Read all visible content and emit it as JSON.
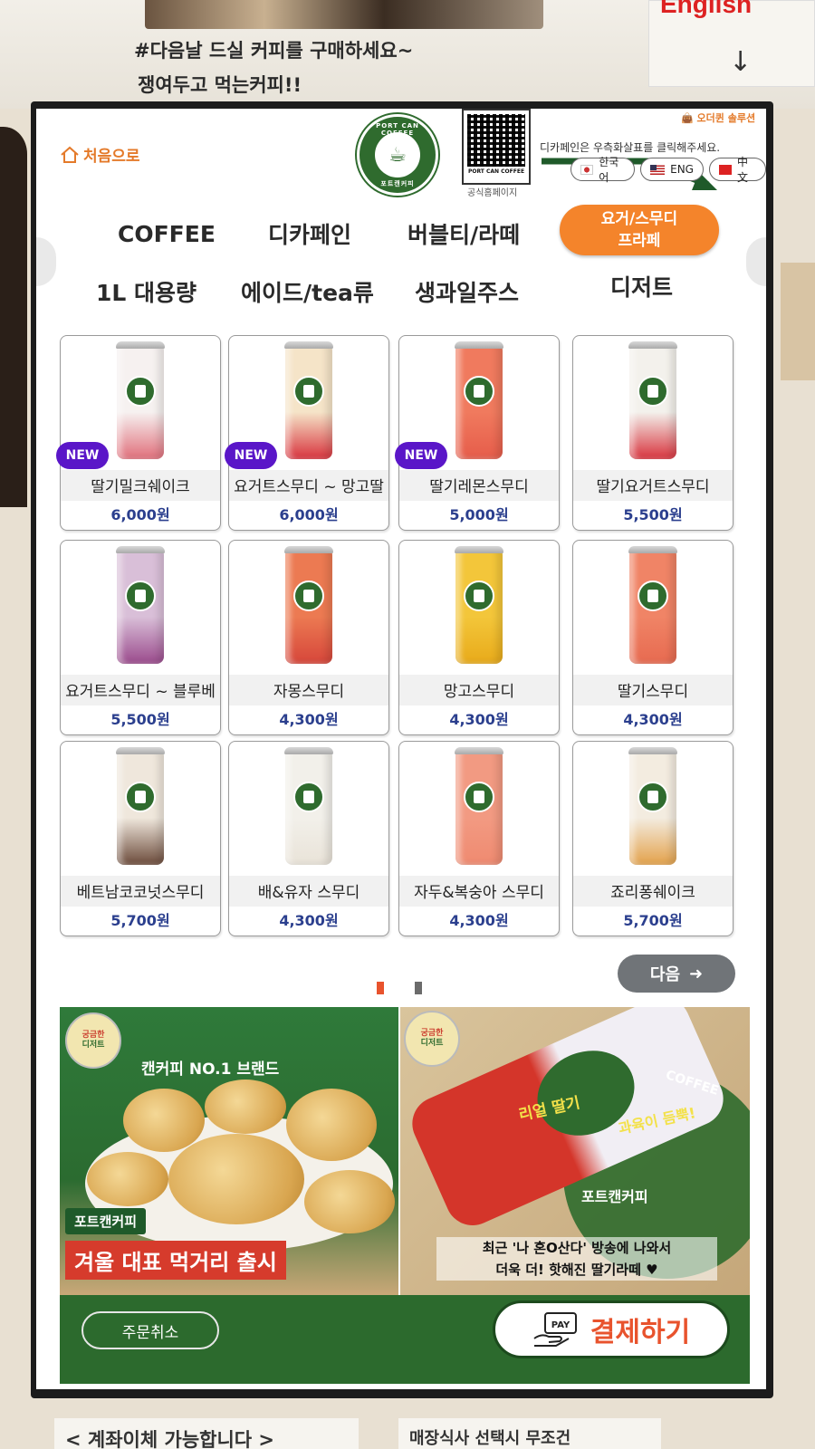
{
  "surroundings": {
    "sticker_line1": "#다음날 드실 커피를 구매하세요~",
    "sticker_line2": "쟁여두고 먹는커피!!",
    "english_sign": "English",
    "bottom_sign_left": "< 계좌이체 가능합니다 >",
    "bottom_sign_right": "매장식사 선택시 무조건"
  },
  "header": {
    "home_label": "처음으로",
    "logo_top": "PORT CAN COFFEE",
    "logo_bottom": "포트캔커피",
    "qr_caption": "PORT CAN COFFEE",
    "qr_label": "공식홈페이지",
    "solution_badge": "오더퀸 솔루션",
    "decaf_notice": "디카페인은 우측화살표를 클릭해주세요.",
    "languages": [
      {
        "label": "한국어",
        "flag": "kr"
      },
      {
        "label": "ENG",
        "flag": "us"
      },
      {
        "label": "中文",
        "flag": "cn"
      }
    ]
  },
  "categories": {
    "row1": [
      "COFFEE",
      "디카페인",
      "버블티/라떼"
    ],
    "active_line1": "요거/스무디",
    "active_line2": "프라페",
    "row2": [
      "1L 대용량",
      "에이드/tea류",
      "생과일주스",
      "디저트"
    ]
  },
  "products": [
    {
      "name": "딸기밀크쉐이크",
      "price": "6,000원",
      "is_new": true,
      "can_color": "#f6f1f0",
      "accent": "#e06e7a"
    },
    {
      "name": "요거트스무디 ~ 망고딸",
      "price": "6,000원",
      "is_new": true,
      "can_color": "#f5e4c8",
      "accent": "#d8323c"
    },
    {
      "name": "딸기레몬스무디",
      "price": "5,000원",
      "is_new": true,
      "can_color": "#f07a5e",
      "accent": "#e65c4a"
    },
    {
      "name": "딸기요거트스무디",
      "price": "5,500원",
      "is_new": false,
      "can_color": "#f3f1ec",
      "accent": "#d8323c"
    },
    {
      "name": "요거트스무디 ~ 블루베",
      "price": "5,500원",
      "is_new": false,
      "can_color": "#d9bfd8",
      "accent": "#9a4a8c"
    },
    {
      "name": "자몽스무디",
      "price": "4,300원",
      "is_new": false,
      "can_color": "#ec7a52",
      "accent": "#d6463a"
    },
    {
      "name": "망고스무디",
      "price": "4,300원",
      "is_new": false,
      "can_color": "#f3c63a",
      "accent": "#e8aa1a"
    },
    {
      "name": "딸기스무디",
      "price": "4,300원",
      "is_new": false,
      "can_color": "#f08466",
      "accent": "#e76a50"
    },
    {
      "name": "베트남코코넛스무디",
      "price": "5,700원",
      "is_new": false,
      "can_color": "#efe7dc",
      "accent": "#6b4a3a"
    },
    {
      "name": "배&유자 스무디",
      "price": "4,300원",
      "is_new": false,
      "can_color": "#f2f0ea",
      "accent": "#e9e3d8"
    },
    {
      "name": "자두&복숭아 스무디",
      "price": "4,300원",
      "is_new": false,
      "can_color": "#f29a82",
      "accent": "#ef8a70"
    },
    {
      "name": "죠리퐁쉐이크",
      "price": "5,700원",
      "is_new": false,
      "can_color": "#f3ece0",
      "accent": "#e3a14a"
    }
  ],
  "paging": {
    "next_label": "다음",
    "active_color": "#e8532d",
    "inactive_color": "#6b6b6b"
  },
  "banners": {
    "left_logo_line1": "궁금한",
    "left_logo_line2": "디저트",
    "left_headline": "캔커피 NO.1 브랜드",
    "left_tag_green": "포트캔커피",
    "left_tag_red": "겨울 대표 먹거리 출시",
    "right_logo_line1": "궁금한",
    "right_logo_line2": "디저트",
    "right_caption_line1": "최근 '나 혼O산다' 방송에 나와서",
    "right_caption_line2": "더욱 더! 핫해진 딸기라떼",
    "right_overlay1": "리얼 딸기",
    "right_overlay2": "과육이 듬뿍!",
    "right_overlay3": "COFFEE",
    "right_overlay4": "포트캔커피"
  },
  "footer": {
    "cancel_label": "주문취소",
    "pay_label": "결제하기",
    "pay_icon_text": "PAY"
  },
  "colors": {
    "brand_green": "#2f6b2e",
    "accent_orange": "#f4842b",
    "new_purple": "#5a16c8",
    "price_blue": "#2b3f8e"
  }
}
